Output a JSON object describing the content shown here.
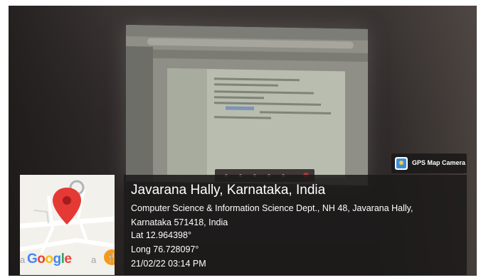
{
  "location": {
    "title": "Javarana Hally, Karnataka, India",
    "address_line1": "Computer Science & Information Science Dept., NH 48, Javarana Hally,",
    "address_line2": "Karnataka 571418, India",
    "latitude": "Lat 12.964398°",
    "longitude": "Long 76.728097°",
    "timestamp": "21/02/22 03:14 PM"
  },
  "map": {
    "logo": "Google",
    "marker_icon": "map-pin-icon",
    "poi_icon": "restaurant-icon",
    "marker_color": "#e53935",
    "poi_color": "#f29b1d"
  },
  "badge": {
    "app_name": "GPS Map Camera",
    "icon": "gps-camera-icon"
  }
}
